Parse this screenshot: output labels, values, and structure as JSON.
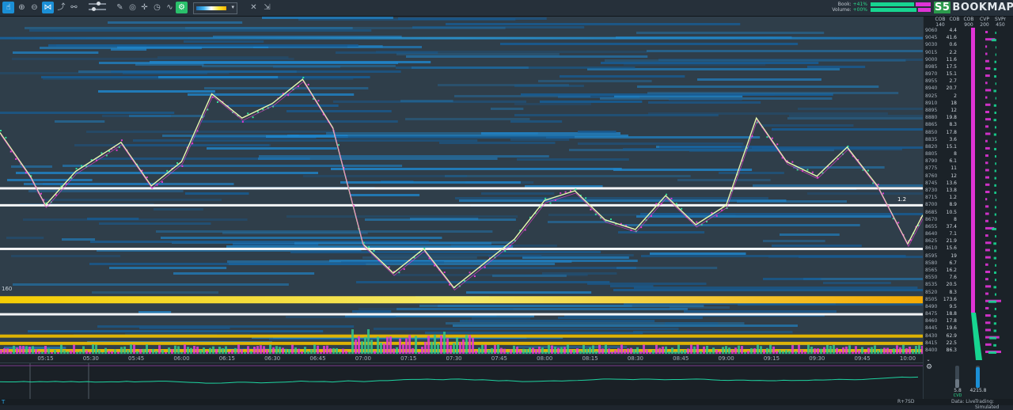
{
  "toolbar": {
    "buttons": [
      {
        "name": "hand-tool-button",
        "glyph": "☝"
      },
      {
        "name": "zoom-in-button",
        "glyph": "⊕"
      },
      {
        "name": "zoom-out-button",
        "glyph": "⊖"
      },
      {
        "name": "network-tool-button",
        "glyph": "⋈"
      },
      {
        "name": "pointer-tool-button",
        "glyph": "⤴"
      },
      {
        "name": "link-tool-button",
        "glyph": "⚯"
      },
      {
        "name": "pencil-tool-button",
        "glyph": "✎"
      },
      {
        "name": "camera-button",
        "glyph": "◎"
      },
      {
        "name": "crosshair-button",
        "glyph": "✛"
      },
      {
        "name": "timer-button",
        "glyph": "◷"
      },
      {
        "name": "line-tool-button",
        "glyph": "∿"
      },
      {
        "name": "chart-settings-button",
        "glyph": "⚙"
      },
      {
        "name": "close-button",
        "glyph": "✕"
      },
      {
        "name": "export-button",
        "glyph": "⇲"
      }
    ],
    "colorbar_caret": "▾"
  },
  "meters": {
    "book_label": "Book:",
    "book_value": "+41%",
    "volume_label": "Volume:",
    "volume_value": "+00%",
    "book_buy_fraction": 0.72,
    "volume_buy_fraction": 0.76
  },
  "brand": {
    "badge": "S5",
    "name": "BOOKMAP"
  },
  "right_panel": {
    "headers": [
      {
        "title": "COB",
        "sub": "140"
      },
      {
        "title": "COB",
        "sub": ""
      },
      {
        "title": "COB",
        "sub": "900"
      },
      {
        "title": "CVP",
        "sub": "200"
      },
      {
        "title": "SVPr",
        "sub": "450"
      }
    ],
    "rows": [
      {
        "price": "9060",
        "cob": "4.4"
      },
      {
        "price": "9045",
        "cob": "41.6"
      },
      {
        "price": "9030",
        "cob": "0.6"
      },
      {
        "price": "9015",
        "cob": "2.2"
      },
      {
        "price": "9000",
        "cob": "11.6"
      },
      {
        "price": "8985",
        "cob": "17.5"
      },
      {
        "price": "8970",
        "cob": "15.1"
      },
      {
        "price": "8955",
        "cob": "2.7"
      },
      {
        "price": "8940",
        "cob": "20.7"
      },
      {
        "price": "8925",
        "cob": "2"
      },
      {
        "price": "8910",
        "cob": "18"
      },
      {
        "price": "8895",
        "cob": "12"
      },
      {
        "price": "8880",
        "cob": "19.8"
      },
      {
        "price": "8865",
        "cob": "8.3"
      },
      {
        "price": "8850",
        "cob": "17.8"
      },
      {
        "price": "8835",
        "cob": "3.6"
      },
      {
        "price": "8820",
        "cob": "15.1"
      },
      {
        "price": "8805",
        "cob": "8"
      },
      {
        "price": "8790",
        "cob": "6.1"
      },
      {
        "price": "8775",
        "cob": "11"
      },
      {
        "price": "8760",
        "cob": "12"
      },
      {
        "price": "8745",
        "cob": "13.6"
      },
      {
        "price": "8730",
        "cob": "13.8"
      },
      {
        "price": "8715",
        "cob": "1.2"
      },
      {
        "price": "8700",
        "cob": "8.9"
      },
      {
        "price": "8685",
        "cob": "10.5"
      },
      {
        "price": "8670",
        "cob": "8"
      },
      {
        "price": "8655",
        "cob": "37.4"
      },
      {
        "price": "8640",
        "cob": "7.1"
      },
      {
        "price": "8625",
        "cob": "21.9"
      },
      {
        "price": "8610",
        "cob": "15.6"
      },
      {
        "price": "8595",
        "cob": "19"
      },
      {
        "price": "8580",
        "cob": "6.7"
      },
      {
        "price": "8565",
        "cob": "16.2"
      },
      {
        "price": "8550",
        "cob": "7.6"
      },
      {
        "price": "8535",
        "cob": "20.5"
      },
      {
        "price": "8520",
        "cob": "8.3"
      },
      {
        "price": "8505",
        "cob": "173.6"
      },
      {
        "price": "8490",
        "cob": "9.5"
      },
      {
        "price": "8475",
        "cob": "18.8"
      },
      {
        "price": "8460",
        "cob": "17.8"
      },
      {
        "price": "8445",
        "cob": "19.6"
      },
      {
        "price": "8430",
        "cob": "62.9"
      },
      {
        "price": "8415",
        "cob": "22.5"
      },
      {
        "price": "8400",
        "cob": "86.3"
      }
    ],
    "left_level_label": "160",
    "price_marker_label": "1.2",
    "down_caret": "⌄",
    "gear_icon": "⚙",
    "cvd_value": "5.8",
    "cvd_label": "CVD",
    "volume_total": "4215.8"
  },
  "time_axis": [
    "05:15",
    "05:30",
    "05:45",
    "06:00",
    "06:15",
    "06:30",
    "06:45",
    "07:00",
    "07:15",
    "07:30",
    "07:45",
    "08:00",
    "08:15",
    "08:30",
    "08:45",
    "09:00",
    "09:15",
    "09:30",
    "09:45",
    "10:00"
  ],
  "status": {
    "left_icon": "T",
    "zoom_label": "R+7SD",
    "data_label": "Data: Live",
    "trading_label": "Trading: Simulated"
  },
  "chart_data": {
    "type": "heatmap",
    "y_axis_label": "Price",
    "x_axis_label": "Time",
    "price_range": [
      8400,
      9060
    ],
    "time_range": [
      "05:00",
      "10:05"
    ],
    "price_path": [
      {
        "time": "05:00",
        "price": 8850
      },
      {
        "time": "05:10",
        "price": 8760
      },
      {
        "time": "05:15",
        "price": 8700
      },
      {
        "time": "05:25",
        "price": 8770
      },
      {
        "time": "05:35",
        "price": 8810
      },
      {
        "time": "05:40",
        "price": 8830
      },
      {
        "time": "05:50",
        "price": 8740
      },
      {
        "time": "06:00",
        "price": 8790
      },
      {
        "time": "06:10",
        "price": 8930
      },
      {
        "time": "06:20",
        "price": 8880
      },
      {
        "time": "06:30",
        "price": 8910
      },
      {
        "time": "06:40",
        "price": 8960
      },
      {
        "time": "06:50",
        "price": 8860
      },
      {
        "time": "07:00",
        "price": 8620
      },
      {
        "time": "07:10",
        "price": 8560
      },
      {
        "time": "07:20",
        "price": 8610
      },
      {
        "time": "07:30",
        "price": 8530
      },
      {
        "time": "07:40",
        "price": 8580
      },
      {
        "time": "07:50",
        "price": 8630
      },
      {
        "time": "08:00",
        "price": 8710
      },
      {
        "time": "08:10",
        "price": 8730
      },
      {
        "time": "08:20",
        "price": 8670
      },
      {
        "time": "08:30",
        "price": 8650
      },
      {
        "time": "08:40",
        "price": 8720
      },
      {
        "time": "08:50",
        "price": 8660
      },
      {
        "time": "09:00",
        "price": 8700
      },
      {
        "time": "09:10",
        "price": 8880
      },
      {
        "time": "09:20",
        "price": 8790
      },
      {
        "time": "09:30",
        "price": 8760
      },
      {
        "time": "09:40",
        "price": 8820
      },
      {
        "time": "09:50",
        "price": 8740
      },
      {
        "time": "10:00",
        "price": 8620
      },
      {
        "time": "10:05",
        "price": 8680
      }
    ],
    "liquidity_levels": [
      {
        "price": 8505,
        "intensity": "very-high"
      },
      {
        "price": 8430,
        "intensity": "high"
      },
      {
        "price": 8415,
        "intensity": "high"
      },
      {
        "price": 8400,
        "intensity": "high"
      },
      {
        "price": 8475,
        "intensity": "medium"
      },
      {
        "price": 8700,
        "intensity": "medium"
      },
      {
        "price": 8610,
        "intensity": "medium"
      },
      {
        "price": 8735,
        "intensity": "medium"
      },
      {
        "price": 9045,
        "intensity": "low"
      }
    ]
  }
}
